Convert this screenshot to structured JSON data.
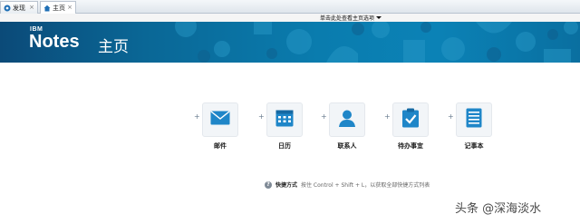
{
  "tabs": [
    {
      "label": "发现",
      "icon": "discover-icon"
    },
    {
      "label": "主页",
      "icon": "home-icon"
    }
  ],
  "options_link": {
    "label": "单击此处查看主页选项"
  },
  "banner": {
    "ibm": "IBM",
    "notes": "Notes",
    "page_title": "主页"
  },
  "tiles": [
    {
      "label": "邮件",
      "icon": "mail-icon"
    },
    {
      "label": "日历",
      "icon": "calendar-icon"
    },
    {
      "label": "联系人",
      "icon": "contacts-icon"
    },
    {
      "label": "待办事宜",
      "icon": "todo-icon"
    },
    {
      "label": "记事本",
      "icon": "notebook-icon"
    }
  ],
  "shortcut": {
    "title": "快捷方式",
    "hint": "按住 Control + Shift + L，以获取全部快捷方式列表"
  },
  "watermark": "头条 @深海淡水",
  "colors": {
    "banner": "#0a7cae",
    "icon_blue": "#1f86c8",
    "tab_bar": "#dfe5ec"
  }
}
